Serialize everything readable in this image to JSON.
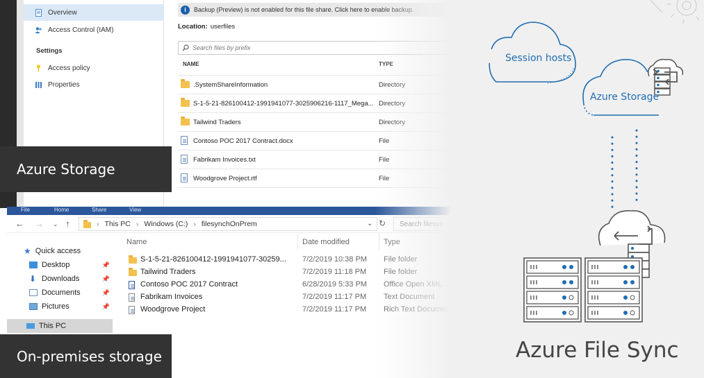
{
  "portal": {
    "nav": {
      "overview": "Overview",
      "access_control": "Access Control (IAM)",
      "settings_header": "Settings",
      "access_policy": "Access policy",
      "properties": "Properties"
    },
    "banner_text": "Backup (Preview) is not enabled for this file share. Click here to enable backup.",
    "location_label": "Location:",
    "location_value": "userfiles",
    "search_placeholder": "Search files by prefix",
    "columns": {
      "name": "NAME",
      "type": "TYPE"
    },
    "rows": [
      {
        "name": ".SystemShareInformation",
        "type": "Directory",
        "icon": "folder-icon"
      },
      {
        "name": "S-1-5-21-826100412-1991941077-3025906216-1117_Mega...",
        "type": "Directory",
        "icon": "folder-icon"
      },
      {
        "name": "Tailwind Traders",
        "type": "Directory",
        "icon": "folder-icon"
      },
      {
        "name": "Contoso POC 2017 Contract.docx",
        "type": "File",
        "icon": "file-icon"
      },
      {
        "name": "Fabrikam Invoices.txt",
        "type": "File",
        "icon": "file-icon"
      },
      {
        "name": "Woodgrove Project.rtf",
        "type": "File",
        "icon": "file-icon"
      }
    ]
  },
  "labels": {
    "azure_storage": "Azure Storage",
    "on_premises": "On-premises storage"
  },
  "explorer": {
    "ribbon": {
      "file": "File",
      "home": "Home",
      "share": "Share",
      "view": "View"
    },
    "path": [
      "This PC",
      "Windows (C:)",
      "filesynchOnPrem"
    ],
    "search_placeholder": "Search filesyn",
    "nav": {
      "quick_access": "Quick access",
      "desktop": "Desktop",
      "downloads": "Downloads",
      "documents": "Documents",
      "pictures": "Pictures",
      "this_pc": "This PC"
    },
    "columns": {
      "name": "Name",
      "date": "Date modified",
      "type": "Type"
    },
    "rows": [
      {
        "name": "S-1-5-21-826100412-1991941077-30259...",
        "date": "7/2/2019 10:38 PM",
        "type": "File folder",
        "icon": "folder-icon"
      },
      {
        "name": "Tailwind Traders",
        "date": "7/2/2019 11:18 PM",
        "type": "File folder",
        "icon": "folder-icon"
      },
      {
        "name": "Contoso POC 2017 Contract",
        "date": "6/28/2019 5:33 PM",
        "type": "Office Open XML ...",
        "icon": "word-doc-icon"
      },
      {
        "name": "Fabrikam Invoices",
        "date": "7/2/2019 11:17 PM",
        "type": "Text Document",
        "icon": "text-file-icon"
      },
      {
        "name": "Woodgrove Project",
        "date": "7/2/2019 11:17 PM",
        "type": "Rich Text Documen",
        "icon": "rtf-file-icon"
      }
    ]
  },
  "diagram": {
    "session_hosts": "Session hosts",
    "azure_storage": "Azure Storage",
    "title": "Azure File Sync"
  },
  "colors": {
    "accent_blue": "#1f6db3",
    "label_bg": "#333333",
    "panel_gray": "#f0f0f0",
    "server_outline": "#555555"
  }
}
